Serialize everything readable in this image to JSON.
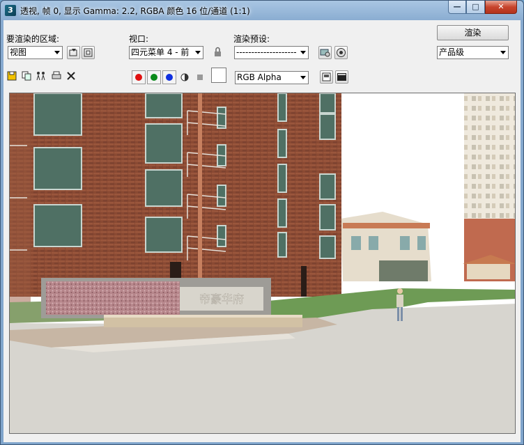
{
  "window": {
    "title": "透视, 帧 0, 显示 Gamma: 2.2, RGBA 颜色 16 位/通道 (1:1)",
    "minimize": "—",
    "maximize": "□",
    "close": "✕"
  },
  "area": {
    "label": "要渲染的区域:",
    "value": "视图"
  },
  "viewport": {
    "label": "视口:",
    "value": "四元菜单 4 - 前"
  },
  "preset": {
    "label": "渲染预设:",
    "value": "--------------------"
  },
  "render": {
    "button": "渲染",
    "quality": "产品级"
  },
  "toolbar": {
    "channel": "RGB Alpha"
  },
  "scene": {
    "sign_text": "帝豪华府"
  }
}
